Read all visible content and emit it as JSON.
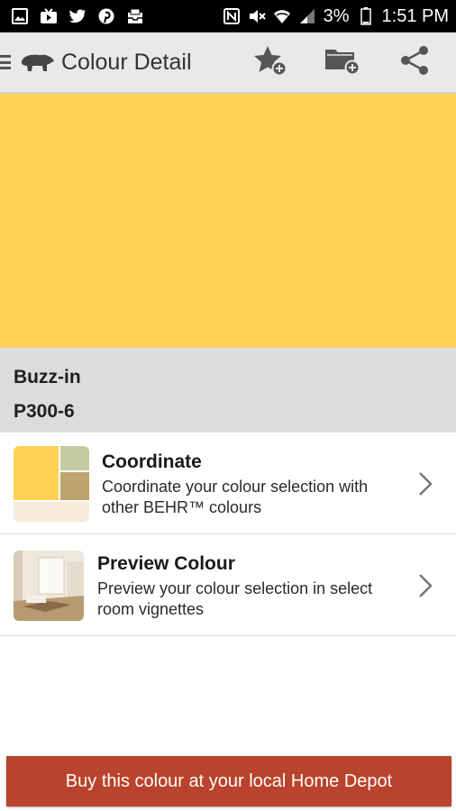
{
  "status_bar": {
    "battery": "3%",
    "time": "1:51 PM",
    "left_icons": [
      "gallery-icon",
      "youtube-icon",
      "twitter-icon",
      "pinterest-icon",
      "inbox-icon"
    ],
    "right_icons": [
      "nfc-icon",
      "mute-icon",
      "wifi-icon",
      "signal-icon",
      "battery-icon"
    ]
  },
  "app_bar": {
    "title": "Colour Detail",
    "actions": [
      "add-favourite-icon",
      "add-folder-icon",
      "share-icon"
    ]
  },
  "swatch": {
    "color": "#ffd157",
    "name": "Buzz-in",
    "code": "P300-6"
  },
  "rows": [
    {
      "title": "Coordinate",
      "description": "Coordinate your colour selection with other BEHR™ colours",
      "thumb_colors": [
        "#ffd157",
        "#c6caa2",
        "#bea56b",
        "#f6ebdc"
      ]
    },
    {
      "title": "Preview Colour",
      "description": "Preview your colour selection in select room vignettes"
    }
  ],
  "buy_button": {
    "label": "Buy this colour at your local Home Depot",
    "color": "#b9432c"
  }
}
